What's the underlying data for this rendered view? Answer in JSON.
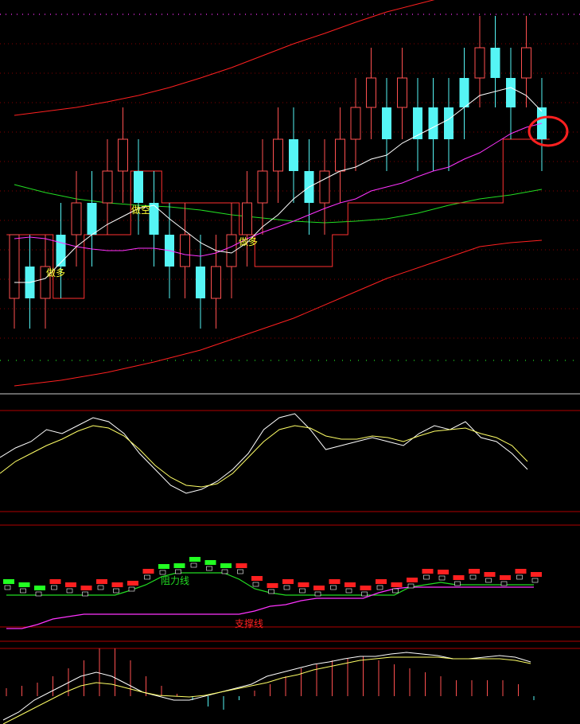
{
  "colors": {
    "background": "#000000",
    "up_candle": "#ff5050",
    "down_candle": "#55f5f5",
    "grid_red": "#b00000",
    "ma_short": "#ffffff",
    "ma_mid": "#ff33ff",
    "ma_long": "#22dd22",
    "ma_long2": "#ff2020",
    "stop_line": "#ff3030",
    "annotation_yellow": "#ffff33",
    "annotation_green": "#22dd22",
    "annotation_red": "#ff2020",
    "marker_circle": "#ff2020"
  },
  "chart_data": [
    {
      "type": "candlestick",
      "panel": "main",
      "candles": [
        {
          "o": 375,
          "c": 295,
          "h": 413,
          "l": 330
        },
        {
          "o": 335,
          "c": 375,
          "h": 413,
          "l": 295
        },
        {
          "o": 375,
          "c": 335,
          "h": 413,
          "l": 295
        },
        {
          "o": 295,
          "c": 335,
          "h": 375,
          "l": 255
        },
        {
          "o": 295,
          "c": 255,
          "h": 335,
          "l": 215
        },
        {
          "o": 255,
          "c": 295,
          "h": 335,
          "l": 215
        },
        {
          "o": 255,
          "c": 215,
          "h": 295,
          "l": 175
        },
        {
          "o": 215,
          "c": 175,
          "h": 255,
          "l": 135
        },
        {
          "o": 215,
          "c": 255,
          "h": 295,
          "l": 175
        },
        {
          "o": 255,
          "c": 295,
          "h": 335,
          "l": 215
        },
        {
          "o": 295,
          "c": 335,
          "h": 375,
          "l": 255
        },
        {
          "o": 335,
          "c": 295,
          "h": 375,
          "l": 255
        },
        {
          "o": 335,
          "c": 375,
          "h": 413,
          "l": 295
        },
        {
          "o": 375,
          "c": 335,
          "h": 413,
          "l": 295
        },
        {
          "o": 335,
          "c": 295,
          "h": 375,
          "l": 255
        },
        {
          "o": 295,
          "c": 255,
          "h": 335,
          "l": 215
        },
        {
          "o": 255,
          "c": 215,
          "h": 295,
          "l": 175
        },
        {
          "o": 215,
          "c": 175,
          "h": 255,
          "l": 135
        },
        {
          "o": 175,
          "c": 215,
          "h": 255,
          "l": 135
        },
        {
          "o": 215,
          "c": 255,
          "h": 295,
          "l": 175
        },
        {
          "o": 255,
          "c": 215,
          "h": 295,
          "l": 175
        },
        {
          "o": 215,
          "c": 175,
          "h": 255,
          "l": 135
        },
        {
          "o": 175,
          "c": 135,
          "h": 215,
          "l": 98
        },
        {
          "o": 135,
          "c": 98,
          "h": 175,
          "l": 60
        },
        {
          "o": 135,
          "c": 175,
          "h": 215,
          "l": 98
        },
        {
          "o": 135,
          "c": 98,
          "h": 175,
          "l": 60
        },
        {
          "o": 135,
          "c": 175,
          "h": 215,
          "l": 98
        },
        {
          "o": 135,
          "c": 175,
          "h": 215,
          "l": 98
        },
        {
          "o": 135,
          "c": 175,
          "h": 215,
          "l": 98
        },
        {
          "o": 98,
          "c": 135,
          "h": 175,
          "l": 60
        },
        {
          "o": 98,
          "c": 60,
          "h": 135,
          "l": 20
        },
        {
          "o": 60,
          "c": 98,
          "h": 135,
          "l": 20
        },
        {
          "o": 98,
          "c": 135,
          "h": 175,
          "l": 60
        },
        {
          "o": 98,
          "c": 60,
          "h": 135,
          "l": 20
        },
        {
          "o": 135,
          "c": 175,
          "h": 215,
          "l": 98
        }
      ],
      "series": [
        {
          "key": "ma_short",
          "x": [
            0,
            1,
            2,
            3,
            4,
            5,
            6,
            7,
            8,
            9,
            10,
            11,
            12,
            13,
            14,
            15,
            16,
            17,
            18,
            19,
            20,
            21,
            22,
            23,
            24,
            25,
            26,
            27,
            28,
            29,
            30,
            31,
            32,
            33,
            34
          ],
          "values": [
            355,
            355,
            350,
            330,
            310,
            295,
            282,
            272,
            262,
            258,
            275,
            290,
            305,
            315,
            318,
            305,
            285,
            270,
            250,
            235,
            225,
            215,
            210,
            200,
            195,
            180,
            170,
            160,
            150,
            135,
            120,
            115,
            110,
            120,
            140
          ]
        },
        {
          "key": "ma_mid",
          "x": [
            0,
            1,
            2,
            3,
            4,
            5,
            6,
            7,
            8,
            9,
            10,
            11,
            12,
            13,
            14,
            15,
            16,
            17,
            18,
            19,
            20,
            21,
            22,
            23,
            24,
            25,
            26,
            27,
            28,
            29,
            30,
            31,
            32,
            33,
            34
          ],
          "values": [
            300,
            298,
            300,
            305,
            310,
            313,
            315,
            315,
            312,
            312,
            315,
            320,
            322,
            318,
            310,
            300,
            292,
            285,
            278,
            270,
            262,
            255,
            250,
            240,
            235,
            230,
            222,
            215,
            210,
            200,
            192,
            180,
            168,
            160,
            155
          ]
        },
        {
          "key": "ma_long",
          "x": [
            0,
            2,
            4,
            6,
            8,
            10,
            12,
            14,
            16,
            18,
            20,
            22,
            24,
            26,
            28,
            30,
            32,
            34
          ],
          "values": [
            232,
            242,
            250,
            255,
            258,
            260,
            264,
            270,
            274,
            278,
            280,
            278,
            275,
            268,
            258,
            250,
            245,
            238
          ]
        },
        {
          "key": "ma_long2",
          "x": [
            0,
            2,
            4,
            6,
            8,
            10,
            12,
            14,
            16,
            18,
            20,
            22,
            24,
            26,
            28,
            30,
            32,
            34
          ],
          "values": [
            145,
            140,
            135,
            128,
            120,
            110,
            98,
            85,
            70,
            55,
            42,
            28,
            15,
            5,
            -5,
            -12,
            -20,
            -25
          ]
        },
        {
          "key": "ma_long3",
          "x": [
            0,
            3,
            6,
            9,
            12,
            15,
            18,
            21,
            24,
            27,
            30,
            32,
            34
          ],
          "values": [
            485,
            478,
            468,
            455,
            440,
            420,
            400,
            375,
            350,
            330,
            310,
            305,
            302
          ]
        },
        {
          "key": "stop_line",
          "x": [
            0,
            1,
            2,
            3,
            4,
            5,
            6,
            7,
            8,
            9,
            10,
            11,
            12,
            13,
            14,
            15,
            16,
            17,
            18,
            19,
            20,
            21,
            22,
            23,
            24,
            25,
            26,
            27,
            28,
            29,
            30,
            31,
            32,
            33,
            34
          ],
          "values": [
            295,
            295,
            295,
            375,
            375,
            295,
            295,
            295,
            215,
            215,
            255,
            255,
            255,
            255,
            255,
            295,
            335,
            335,
            335,
            335,
            335,
            295,
            255,
            255,
            255,
            255,
            255,
            255,
            255,
            255,
            255,
            255,
            175,
            175,
            175
          ]
        }
      ],
      "annotations": [
        {
          "text": "做多",
          "color_key": "annotation_yellow"
        },
        {
          "text": "做空",
          "color_key": "annotation_yellow"
        },
        {
          "text": "做多",
          "color_key": "annotation_yellow"
        }
      ]
    },
    {
      "type": "line",
      "panel": "oscillator",
      "series": [
        {
          "key": "k",
          "values": [
            575,
            563,
            555,
            540,
            545,
            535,
            525,
            530,
            545,
            570,
            590,
            610,
            620,
            615,
            605,
            590,
            570,
            540,
            525,
            520,
            540,
            565,
            560,
            555,
            550,
            555,
            560,
            545,
            535,
            540,
            530,
            550,
            555,
            570,
            590
          ]
        },
        {
          "key": "d",
          "values": [
            595,
            580,
            570,
            560,
            552,
            542,
            535,
            538,
            548,
            565,
            585,
            600,
            610,
            612,
            608,
            595,
            575,
            555,
            540,
            535,
            538,
            548,
            552,
            552,
            548,
            550,
            555,
            548,
            542,
            540,
            538,
            545,
            550,
            560,
            580
          ]
        }
      ]
    },
    {
      "type": "bar",
      "panel": "resistance_support",
      "labels": [
        "阻力线",
        "支撑线"
      ],
      "resistance_line": [
        748,
        748,
        748,
        748,
        748,
        748,
        748,
        748,
        742,
        735,
        725,
        720,
        720,
        720,
        720,
        728,
        740,
        745,
        748,
        748,
        748,
        748,
        748,
        748,
        748,
        748,
        738,
        735,
        732,
        735,
        735,
        735,
        735,
        735,
        735
      ],
      "support_line": [
        790,
        790,
        785,
        778,
        775,
        772,
        772,
        772,
        772,
        772,
        772,
        772,
        772,
        772,
        772,
        772,
        768,
        762,
        760,
        755,
        752,
        752,
        752,
        752,
        745,
        740,
        738,
        738,
        738,
        738,
        738,
        738,
        738,
        738,
        738
      ]
    },
    {
      "type": "bar",
      "panel": "histogram",
      "values": [
        865,
        862,
        858,
        850,
        840,
        830,
        815,
        815,
        830,
        850,
        862,
        872,
        880,
        888,
        892,
        880,
        868,
        860,
        850,
        840,
        835,
        830,
        828,
        825,
        830,
        835,
        840,
        845,
        850,
        855,
        855,
        855,
        855,
        860,
        880
      ],
      "series": [
        {
          "key": "white",
          "values": [
            905,
            895,
            880,
            870,
            860,
            850,
            845,
            850,
            860,
            870,
            875,
            880,
            880,
            875,
            870,
            865,
            860,
            850,
            845,
            840,
            835,
            832,
            828,
            825,
            825,
            822,
            820,
            822,
            824,
            828,
            828,
            826,
            824,
            826,
            832
          ]
        },
        {
          "key": "yellow",
          "values": [
            910,
            900,
            890,
            880,
            870,
            862,
            858,
            860,
            865,
            870,
            874,
            875,
            876,
            874,
            870,
            866,
            862,
            858,
            852,
            848,
            842,
            838,
            834,
            830,
            828,
            826,
            826,
            826,
            826,
            828,
            828,
            828,
            828,
            830,
            834
          ]
        }
      ]
    }
  ]
}
